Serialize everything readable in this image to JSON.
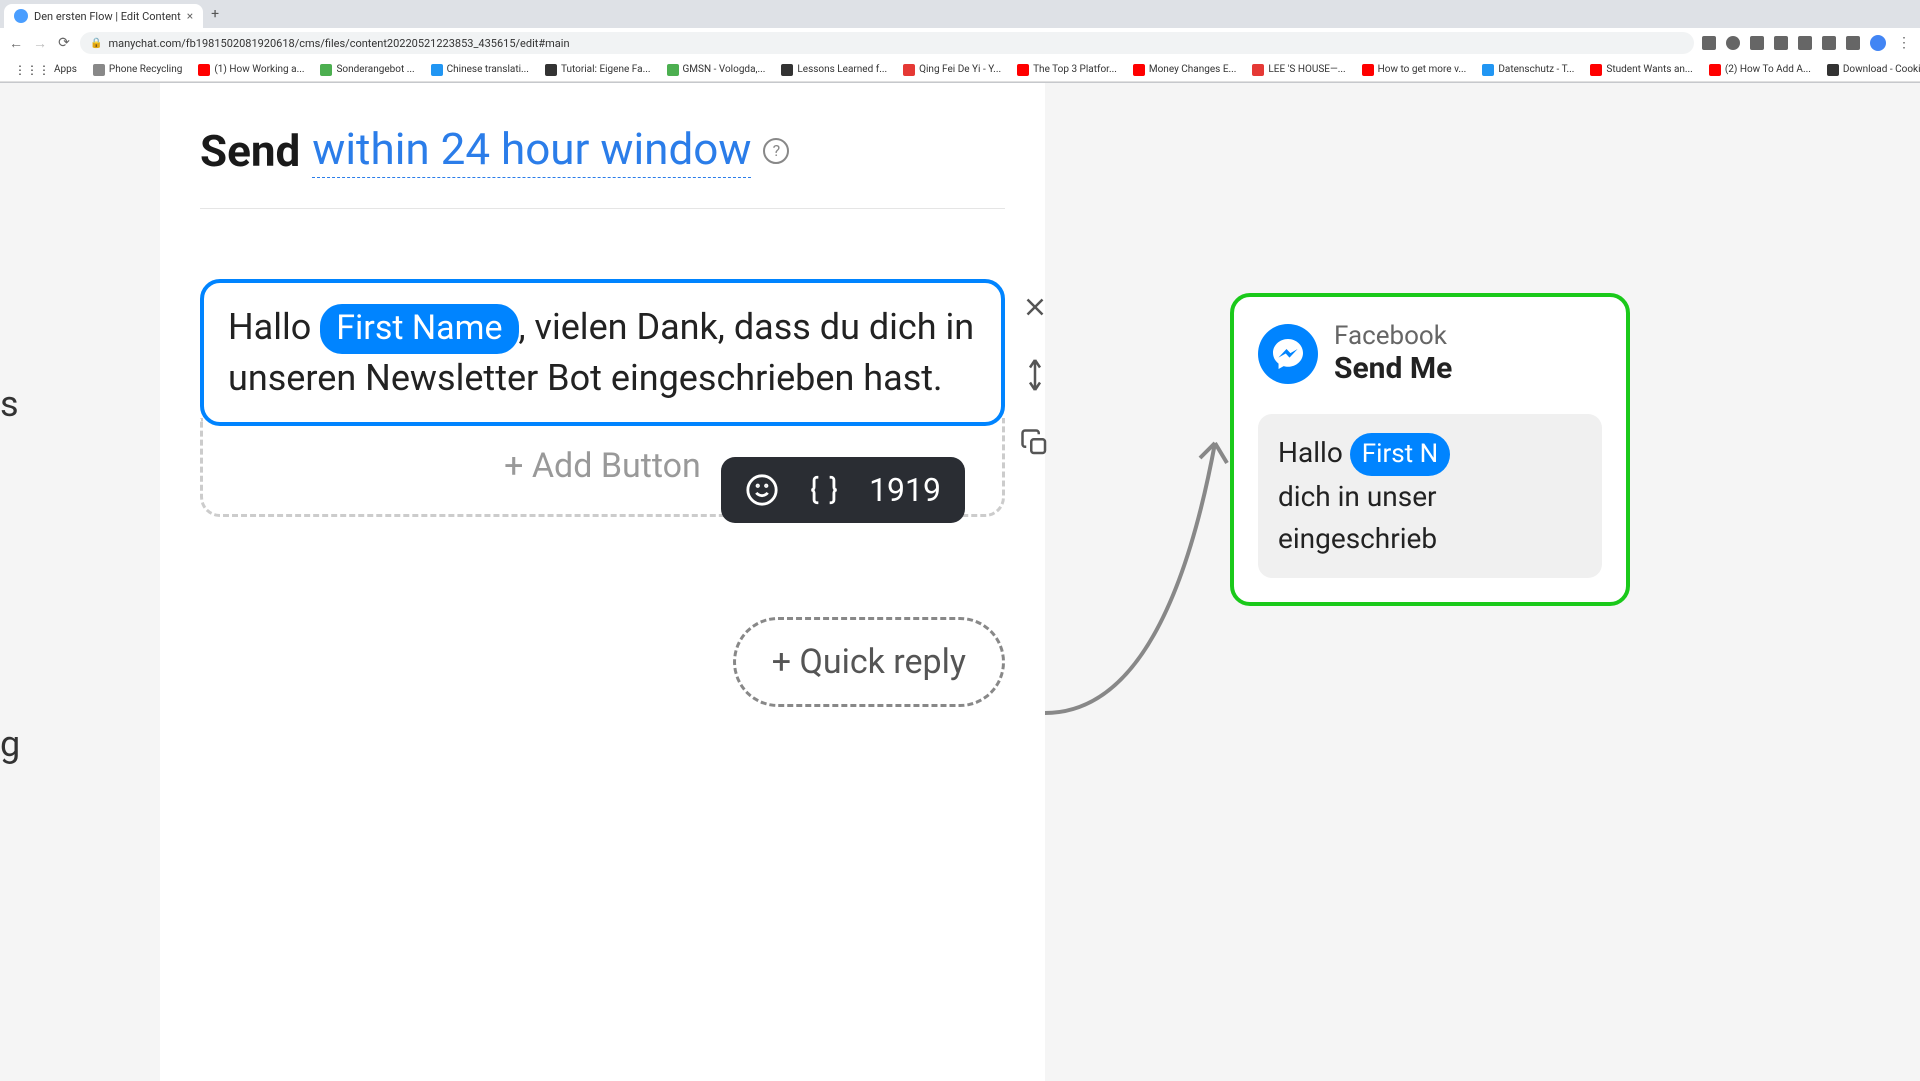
{
  "browser": {
    "tab_title": "Den ersten Flow | Edit Content",
    "url": "manychat.com/fb198150208192061​8/cms/files/content20220521223853_435615/edit#main",
    "bookmarks": [
      {
        "label": "Apps",
        "type": "apps"
      },
      {
        "label": "Phone Recycling",
        "type": "circle"
      },
      {
        "label": "(1) How Working a...",
        "type": "youtube"
      },
      {
        "label": "Sonderangebot ...",
        "type": "green"
      },
      {
        "label": "Chinese translati...",
        "type": "blue"
      },
      {
        "label": "Tutorial: Eigene Fa...",
        "type": "black"
      },
      {
        "label": "GMSN - Vologda,...",
        "type": "green"
      },
      {
        "label": "Lessons Learned f...",
        "type": "black"
      },
      {
        "label": "Qing Fei De Yi - Y...",
        "type": "red"
      },
      {
        "label": "The Top 3 Platfor...",
        "type": "youtube"
      },
      {
        "label": "Money Changes E...",
        "type": "youtube"
      },
      {
        "label": "LEE 'S HOUSE—...",
        "type": "red"
      },
      {
        "label": "How to get more v...",
        "type": "youtube"
      },
      {
        "label": "Datenschutz - T...",
        "type": "blue"
      },
      {
        "label": "Student Wants an...",
        "type": "youtube"
      },
      {
        "label": "(2) How To Add A...",
        "type": "youtube"
      },
      {
        "label": "Download - Cooki...",
        "type": "black"
      }
    ]
  },
  "editor": {
    "send_label": "Send",
    "window_label": "within 24 hour window",
    "message": {
      "prefix": "Hallo ",
      "variable": "First Name",
      "suffix": ", vielen Dank, dass du dich in unseren Newsletter Bot eingeschrieben hast."
    },
    "add_button_label": "+ Add Button",
    "char_count": "1919",
    "quick_reply_label": "+ Quick reply"
  },
  "preview": {
    "platform": "Facebook",
    "action": "Send Me",
    "message": {
      "prefix": "Hallo ",
      "variable": "First N",
      "line2": "dich in unser",
      "line3": "eingeschrieb"
    }
  }
}
